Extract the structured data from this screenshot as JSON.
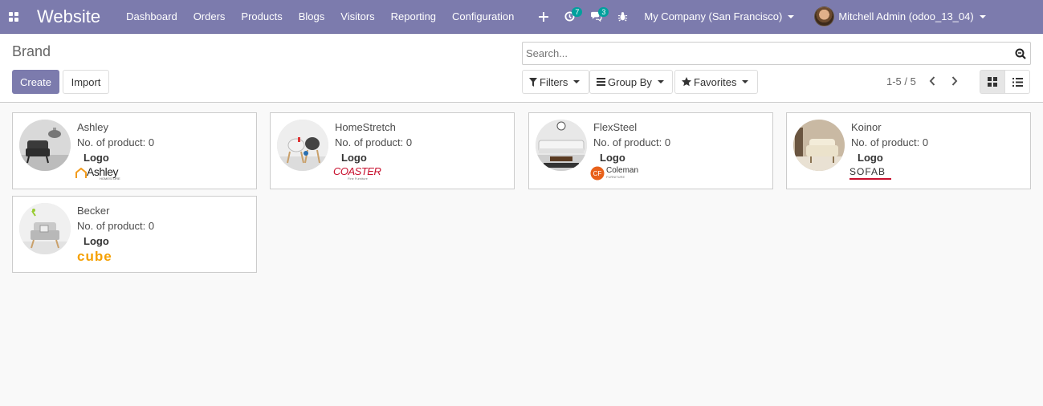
{
  "navbar": {
    "app_name": "Website",
    "menu": [
      "Dashboard",
      "Orders",
      "Products",
      "Blogs",
      "Visitors",
      "Reporting",
      "Configuration"
    ],
    "activity_count": "7",
    "message_count": "3",
    "company": "My Company (San Francisco)",
    "user": "Mitchell Admin (odoo_13_04)"
  },
  "control": {
    "breadcrumb": "Brand",
    "create_label": "Create",
    "import_label": "Import",
    "search_placeholder": "Search...",
    "filters_label": "Filters",
    "groupby_label": "Group By",
    "favorites_label": "Favorites",
    "pager": "1-5 / 5"
  },
  "brands": [
    {
      "name": "Ashley",
      "count_label": "No. of product: 0",
      "logo_label": "Logo",
      "logo_text": "Ashley",
      "logo_subtext": "HOMESTORE"
    },
    {
      "name": "HomeStretch",
      "count_label": "No. of product: 0",
      "logo_label": "Logo",
      "logo_text": "COASTER",
      "logo_subtext": "Fine Furniture"
    },
    {
      "name": "FlexSteel",
      "count_label": "No. of product: 0",
      "logo_label": "Logo",
      "logo_text": "Coleman",
      "logo_subtext": "FURNITURE"
    },
    {
      "name": "Koinor",
      "count_label": "No. of product: 0",
      "logo_label": "Logo",
      "logo_text": "SOFAB",
      "logo_subtext": ""
    },
    {
      "name": "Becker",
      "count_label": "No. of product: 0",
      "logo_label": "Logo",
      "logo_text": "cube",
      "logo_subtext": ""
    }
  ],
  "colors": {
    "navbar": "#7c7bad",
    "badge": "#00a09d",
    "create_button": "#7c7bad"
  }
}
